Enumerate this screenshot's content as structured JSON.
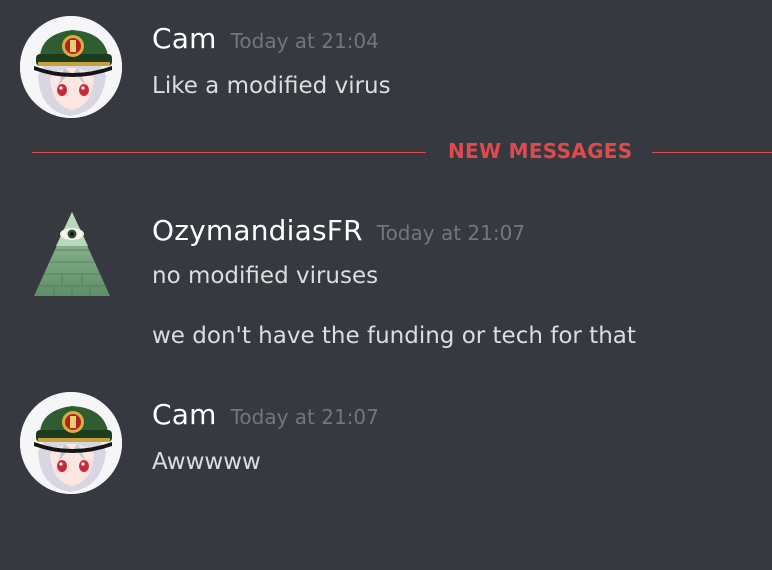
{
  "messages": {
    "group1": {
      "username": "Cam",
      "timestamp": "Today at 21:04",
      "lines": [
        "Like a modified virus"
      ]
    },
    "divider": {
      "label": "NEW MESSAGES"
    },
    "group2": {
      "username": "OzymandiasFR",
      "timestamp": "Today at 21:07",
      "lines": [
        "no modified viruses",
        "we don't have the funding or tech for that"
      ]
    },
    "group3": {
      "username": "Cam",
      "timestamp": "Today at 21:07",
      "lines": [
        "Awwwww"
      ]
    }
  },
  "icons": {
    "cam_avatar": "anime-officer-avatar",
    "ozymandias_avatar": "illuminati-pyramid-avatar"
  },
  "colors": {
    "background": "#36393f",
    "username": "#ffffff",
    "timestamp": "#72767d",
    "message": "#dcddde",
    "new_messages": "#e04a4d"
  }
}
